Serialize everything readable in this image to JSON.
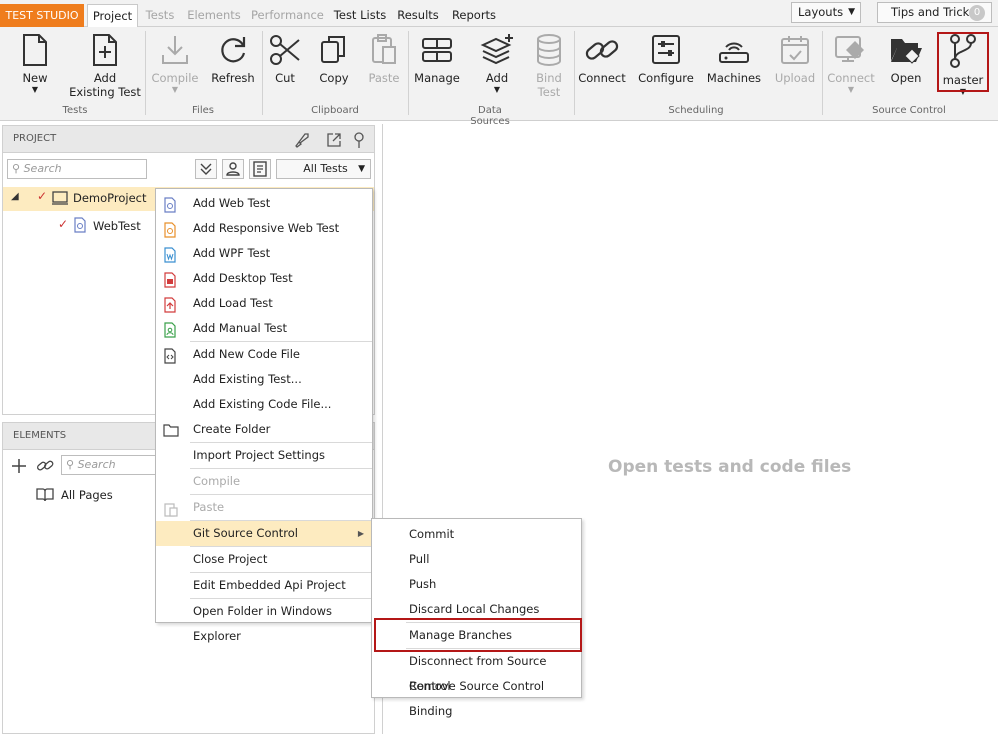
{
  "app": {
    "brand": "TEST STUDIO"
  },
  "tabs": [
    "Project",
    "Tests",
    "Elements",
    "Performance",
    "Test Lists",
    "Results",
    "Reports"
  ],
  "top_right": {
    "layouts": "Layouts",
    "tips": "Tips and Tricks",
    "tips_count": "0"
  },
  "ribbon": {
    "new": "New",
    "add_existing_1": "Add",
    "add_existing_2": "Existing Test",
    "compile": "Compile",
    "refresh": "Refresh",
    "cut": "Cut",
    "copy": "Copy",
    "paste": "Paste",
    "manage": "Manage",
    "add": "Add",
    "bind_1": "Bind",
    "bind_2": "Test",
    "connect": "Connect",
    "configure": "Configure",
    "machines": "Machines",
    "upload": "Upload",
    "sc_connect": "Connect",
    "open": "Open",
    "master": "master",
    "groups": {
      "tests": "Tests",
      "files": "Files",
      "clipboard": "Clipboard",
      "data_sources": "Data Sources",
      "scheduling": "Scheduling",
      "source_control": "Source Control"
    }
  },
  "project_panel": {
    "title": "PROJECT",
    "search_placeholder": "Search",
    "filter": "All Tests",
    "tree": {
      "project": "DemoProject",
      "test": "WebTest"
    }
  },
  "elements_panel": {
    "title": "ELEMENTS",
    "search_placeholder": "Search",
    "all_pages": "All Pages"
  },
  "main": {
    "hint": "Open tests and code files"
  },
  "context_menu": {
    "items": [
      "Add Web Test",
      "Add Responsive Web Test",
      "Add WPF Test",
      "Add Desktop Test",
      "Add Load Test",
      "Add Manual Test",
      "Add New Code File",
      "Add Existing Test...",
      "Add Existing Code File...",
      "Create Folder",
      "Import Project Settings",
      "Compile",
      "Paste",
      "Git Source Control",
      "Close Project",
      "Edit Embedded Api Project",
      "Open Folder in Windows Explorer"
    ]
  },
  "git_submenu": {
    "items": [
      "Commit",
      "Pull",
      "Push",
      "Discard Local Changes",
      "Manage Branches",
      "Disconnect from Source Control",
      "Remove Source Control Binding"
    ]
  },
  "colors": {
    "brand": "#ef7d1d",
    "highlight_border": "#b41717",
    "menu_hover": "#fdebc0"
  }
}
